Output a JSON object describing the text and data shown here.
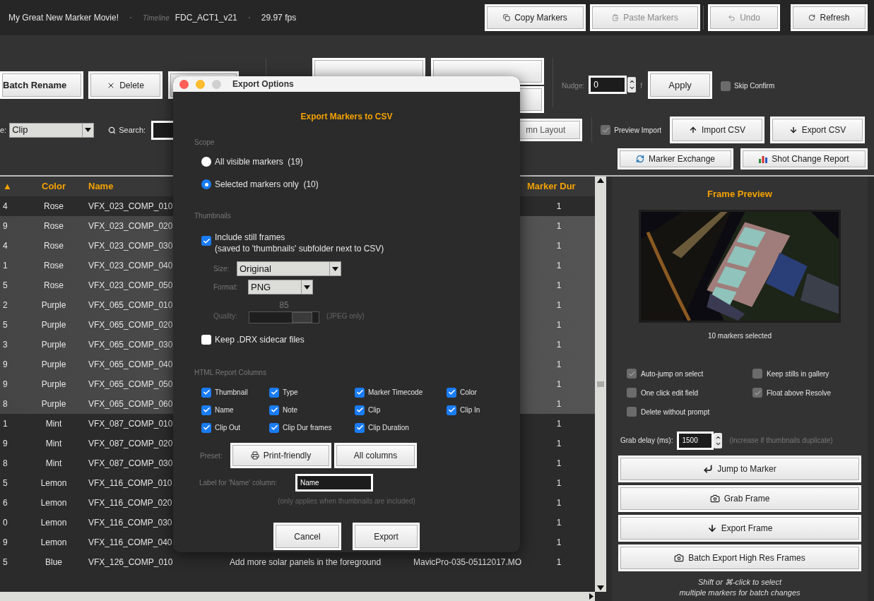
{
  "header": {
    "project": "My Great New Marker Movie!",
    "timeline_label": "Timeline",
    "timeline": "FDC_ACT1_v21",
    "fps": "29.97 fps",
    "copy_markers": {
      "label": "Copy Markers",
      "disabled": false
    },
    "paste_markers": {
      "label": "Paste Markers",
      "disabled": true
    },
    "undo": {
      "label": "Undo",
      "disabled": true
    },
    "refresh": {
      "label": "Refresh",
      "disabled": false
    }
  },
  "toolbar": {
    "batch_rename": "Batch Rename",
    "delete": "Delete",
    "nudge": {
      "label": "Nudge:",
      "value": "0",
      "unit": "f"
    },
    "apply": "Apply",
    "skip_confirm": {
      "label": "Skip Confirm",
      "checked": false
    },
    "type_label": "e:",
    "type_value": "Clip",
    "search_label": "Search:",
    "column_layout": "mn Layout",
    "preview_import": {
      "label": "Preview Import",
      "checked": true
    },
    "import_csv": "Import CSV",
    "export_csv": "Export CSV",
    "marker_exchange": "Marker Exchange",
    "shot_change_report": "Shot Change Report"
  },
  "table": {
    "headers": [
      "▲",
      "Color",
      "Name",
      "Marker Dur"
    ],
    "rows": [
      {
        "selected": false,
        "column_1": "4",
        "marker_color": "Rose",
        "name": "VFX_023_COMP_010",
        "marker_dur": "1"
      },
      {
        "selected": true,
        "column_1": "9",
        "marker_color": "Rose",
        "name": "VFX_023_COMP_020",
        "marker_dur": "1"
      },
      {
        "selected": true,
        "column_1": "4",
        "marker_color": "Rose",
        "name": "VFX_023_COMP_030",
        "marker_dur": "1"
      },
      {
        "selected": true,
        "column_1": "1",
        "marker_color": "Rose",
        "name": "VFX_023_COMP_040",
        "marker_dur": "1"
      },
      {
        "selected": true,
        "column_1": "5",
        "marker_color": "Rose",
        "name": "VFX_023_COMP_050",
        "marker_dur": "1"
      },
      {
        "selected": true,
        "column_1": "2",
        "marker_color": "Purple",
        "name": "VFX_065_COMP_010",
        "marker_dur": "1"
      },
      {
        "selected": true,
        "column_1": "5",
        "marker_color": "Purple",
        "name": "VFX_065_COMP_020",
        "marker_dur": "1"
      },
      {
        "selected": true,
        "column_1": "3",
        "marker_color": "Purple",
        "name": "VFX_065_COMP_030",
        "marker_dur": "1"
      },
      {
        "selected": true,
        "column_1": "9",
        "marker_color": "Purple",
        "name": "VFX_065_COMP_040",
        "marker_dur": "1"
      },
      {
        "selected": true,
        "column_1": "9",
        "marker_color": "Purple",
        "name": "VFX_065_COMP_050",
        "marker_dur": "1"
      },
      {
        "selected": true,
        "column_1": "8",
        "marker_color": "Purple",
        "name": "VFX_065_COMP_060",
        "marker_dur": "1"
      },
      {
        "selected": false,
        "column_1": "1",
        "marker_color": "Mint",
        "name": "VFX_087_COMP_010",
        "marker_dur": "1"
      },
      {
        "selected": false,
        "column_1": "9",
        "marker_color": "Mint",
        "name": "VFX_087_COMP_020",
        "marker_dur": "1"
      },
      {
        "selected": false,
        "column_1": "8",
        "marker_color": "Mint",
        "name": "VFX_087_COMP_030",
        "marker_dur": "1"
      },
      {
        "selected": false,
        "column_1": "5",
        "marker_color": "Lemon",
        "name": "VFX_116_COMP_010",
        "marker_dur": "1"
      },
      {
        "selected": false,
        "column_1": "6",
        "marker_color": "Lemon",
        "name": "VFX_116_COMP_020",
        "marker_dur": "1"
      },
      {
        "selected": false,
        "column_1": "0",
        "marker_color": "Lemon",
        "name": "VFX_116_COMP_030",
        "marker_dur": "1"
      },
      {
        "selected": false,
        "column_1": "9",
        "marker_color": "Lemon",
        "name": "VFX_116_COMP_040",
        "marker_dur": "1"
      },
      {
        "selected": false,
        "column_1": "5",
        "marker_color": "Blue",
        "name": "VFX_126_COMP_010",
        "column_4": "Add more solar panels in the foreground",
        "column_5": "MavicPro-035-05112017.MO",
        "marker_dur": "1"
      }
    ]
  },
  "frame_preview": {
    "title": "Frame Preview",
    "status": "10 markers selected",
    "options": [
      {
        "label": "Auto-jump on select",
        "checked": true
      },
      {
        "label": "Keep stills in gallery",
        "checked": false
      },
      {
        "label": "One click edit field",
        "checked": false
      },
      {
        "label": "Float above Resolve",
        "checked": true
      },
      {
        "label": "Delete without prompt",
        "checked": false
      }
    ],
    "grab_delay": {
      "label": "Grab delay (ms):",
      "value": "1500",
      "hint": "(increase if thumbnails duplicate)"
    },
    "actions": [
      {
        "label": "Jump to Marker",
        "kind": "jump"
      },
      {
        "label": "Grab Frame",
        "kind": "grab"
      },
      {
        "label": "Export Frame",
        "kind": "export"
      },
      {
        "label": "Batch Export High Res Frames",
        "kind": "batch"
      }
    ],
    "hint": [
      "Shift or ⌘-click to select",
      "multiple markers for batch changes"
    ]
  },
  "dialog": {
    "title": "Export Options",
    "heading": "Export Markers to CSV",
    "scope_label": "Scope",
    "scope": [
      {
        "label": "All visible markers  (19)",
        "selected": false
      },
      {
        "label": "Selected markers only  (10)",
        "selected": true
      }
    ],
    "thumbnails_label": "Thumbnails",
    "include_stills": {
      "label": "Include still frames",
      "sublabel": "(saved to 'thumbnails' subfolder next to CSV)",
      "checked": true
    },
    "size": {
      "label": "Size:",
      "value": "Original"
    },
    "format": {
      "label": "Format:",
      "value": "PNG"
    },
    "quality": {
      "label": "Quality:",
      "reading": "85",
      "level": 0.85,
      "disabled": true,
      "note": "(JPEG only)"
    },
    "keep_drx": {
      "label": "Keep .DRX sidecar files",
      "checked": false
    },
    "columns_label": "HTML Report Columns",
    "columns": [
      {
        "label": "Thumbnail",
        "checked": true
      },
      {
        "label": "Type",
        "checked": true
      },
      {
        "label": "Marker Timecode",
        "checked": true
      },
      {
        "label": "Color",
        "checked": true
      },
      {
        "label": "Name",
        "checked": true
      },
      {
        "label": "Note",
        "checked": true
      },
      {
        "label": "Clip",
        "checked": true
      },
      {
        "label": "Clip In",
        "checked": true
      },
      {
        "label": "Clip Out",
        "checked": true
      },
      {
        "label": "Clip Dur frames",
        "checked": true
      },
      {
        "label": "Clip Duration",
        "checked": true
      }
    ],
    "preset_label": "Preset:",
    "print_friendly": "Print-friendly",
    "all_columns": "All columns",
    "name_column": {
      "label": "Label for 'Name' column:",
      "value": "Name"
    },
    "note": "(only applies when thumbnails are included)",
    "cancel": "Cancel",
    "export": "Export"
  }
}
